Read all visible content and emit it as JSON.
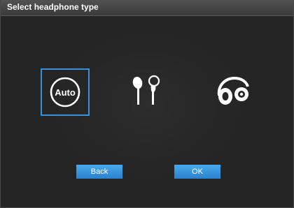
{
  "dialog": {
    "title": "Select headphone type"
  },
  "options": [
    {
      "id": "auto",
      "label": "Auto",
      "icon": "auto-circle-icon",
      "selected": true
    },
    {
      "id": "earbud",
      "label": "",
      "icon": "earbud-headphones-icon",
      "selected": false
    },
    {
      "id": "over-ear",
      "label": "",
      "icon": "over-ear-headphones-icon",
      "selected": false
    }
  ],
  "buttons": {
    "back_label": "Back",
    "ok_label": "OK"
  },
  "colors": {
    "background": "#262626",
    "titlebar": "#3a3a3a",
    "selection_border": "#3a8fd6",
    "button": "#2a82cc",
    "text": "#ffffff"
  }
}
